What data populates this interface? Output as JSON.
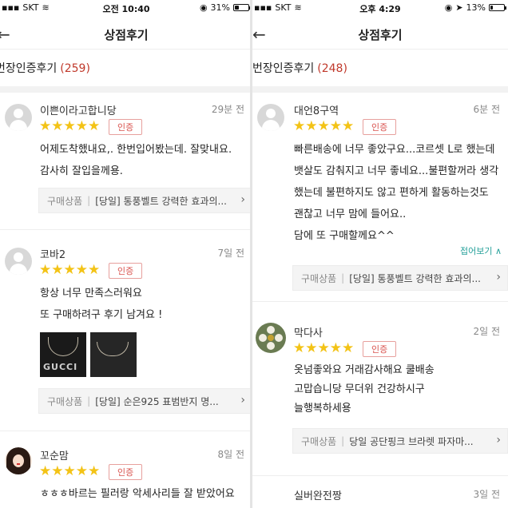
{
  "left": {
    "status": {
      "carrier": "SKT",
      "time": "오전 10:40",
      "battery": "31%",
      "battery_level": 0.31
    },
    "nav": {
      "back_icon": "←",
      "title": "상점후기"
    },
    "section": {
      "label": "번장인증후기",
      "count": "(259)"
    },
    "reviews": [
      {
        "name": "이쁜이라고합니당",
        "when": "29분 전",
        "stars": "★★★★★",
        "rating": 5,
        "badge": "인증",
        "lines": [
          "어제도착했내요,. 한번입어봤는데. 잘맞내요.",
          "감사히 잘입을께용."
        ],
        "product": {
          "label": "구매상품",
          "name": "[당일] 통풍벨트 강력한 효과의..."
        }
      },
      {
        "name": "코바2",
        "when": "7일 전",
        "stars": "★★★★★",
        "rating": 5,
        "badge": "인증",
        "lines": [
          "항상 너무 만족스러워요",
          "또 구매하려구 후기 남겨요 !"
        ],
        "photo_text": "GUCCI",
        "product": {
          "label": "구매상품",
          "name": "[당일] 순은925 표범반지 명..."
        }
      },
      {
        "name": "꼬순맘",
        "when": "8일 전",
        "stars": "★★★★★",
        "rating": 5,
        "badge": "인증",
        "lines": [
          "ㅎㅎㅎ바르는 필러랑 악세사리들 잘 받았어요"
        ]
      }
    ]
  },
  "right": {
    "status": {
      "carrier": "SKT",
      "time": "오후 4:29",
      "battery": "13%",
      "battery_level": 0.13
    },
    "nav": {
      "back_icon": "←",
      "title": "상점후기"
    },
    "section": {
      "label": "번장인증후기",
      "count": "(248)"
    },
    "reviews": [
      {
        "name": "대언8구역",
        "when": "6분 전",
        "stars": "★★★★★",
        "rating": 5,
        "badge": "인증",
        "lines": [
          "빠른배송에 너무 좋았구요...코르셋 L로 했는데",
          "뱃살도 감춰지고 너무 좋네요...불편할꺼라 생각",
          "했는데 불편하지도 않고 편하게 활동하는것도",
          "괜찮고 너무 맘에 들어요..",
          "담에 또 구매할께요^^"
        ],
        "collapse": "접어보기 ∧",
        "product": {
          "label": "구매상품",
          "name": "[당일] 통풍벨트 강력한 효과의..."
        }
      },
      {
        "name": "막다사",
        "when": "2일 전",
        "stars": "★★★★★",
        "rating": 5,
        "badge": "인증",
        "lines": [
          "옷넘좋와요 거래감사해요 쿨배송",
          "고맙습니당  무더위  건강하시구",
          "늘행복하세용"
        ],
        "product": {
          "label": "구매상품",
          "name": "당일 공단핑크 브라렛 파자마..."
        }
      },
      {
        "name": "실버완전짱",
        "when": "3일 전"
      }
    ]
  },
  "colors": {
    "star": "#f3c316",
    "badge": "#d9534f",
    "count": "#c0392b",
    "link": "#27a19b"
  }
}
